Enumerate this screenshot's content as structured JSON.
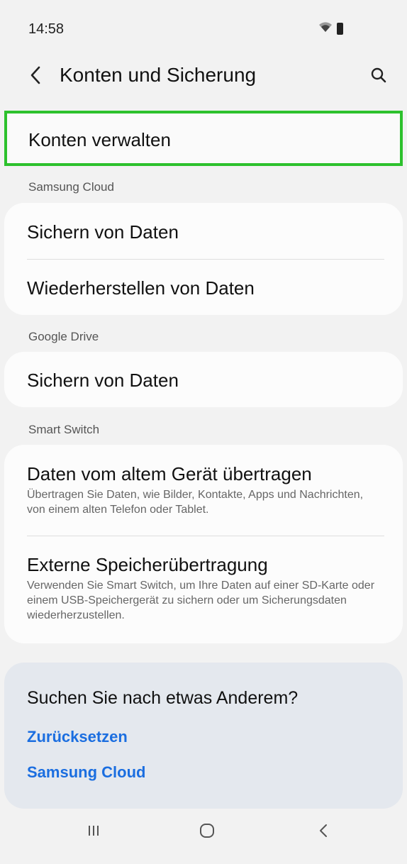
{
  "status_bar": {
    "time": "14:58",
    "icons": [
      "wifi-icon",
      "battery-icon"
    ]
  },
  "app_bar": {
    "back_icon": "back-arrow-icon",
    "title": "Konten und Sicherung",
    "search_icon": "search-icon"
  },
  "highlighted_item": {
    "label": "Konten verwalten",
    "highlight_color": "#2dc12d"
  },
  "sections": [
    {
      "header": "Samsung Cloud",
      "items": [
        {
          "title": "Sichern von Daten"
        },
        {
          "title": "Wiederherstellen von Daten"
        }
      ]
    },
    {
      "header": "Google Drive",
      "items": [
        {
          "title": "Sichern von Daten"
        }
      ]
    },
    {
      "header": "Smart Switch",
      "items": [
        {
          "title": "Daten vom altem Gerät übertragen",
          "description": "Übertragen Sie Daten, wie Bilder, Kontakte, Apps und Nachrichten, von einem alten Telefon oder Tablet."
        },
        {
          "title": "Externe Speicherübertragung",
          "description": "Verwenden Sie Smart Switch, um Ihre Daten auf einer SD-Karte oder einem USB-Speichergerät zu sichern oder um Sicherungsdaten wiederherzustellen."
        }
      ]
    }
  ],
  "suggestions": {
    "title": "Suchen Sie nach etwas Anderem?",
    "links": [
      "Zurücksetzen",
      "Samsung Cloud"
    ],
    "link_color": "#1b6ee0"
  },
  "nav_bar": {
    "buttons": [
      "recent-apps-icon",
      "home-icon",
      "back-icon"
    ]
  }
}
